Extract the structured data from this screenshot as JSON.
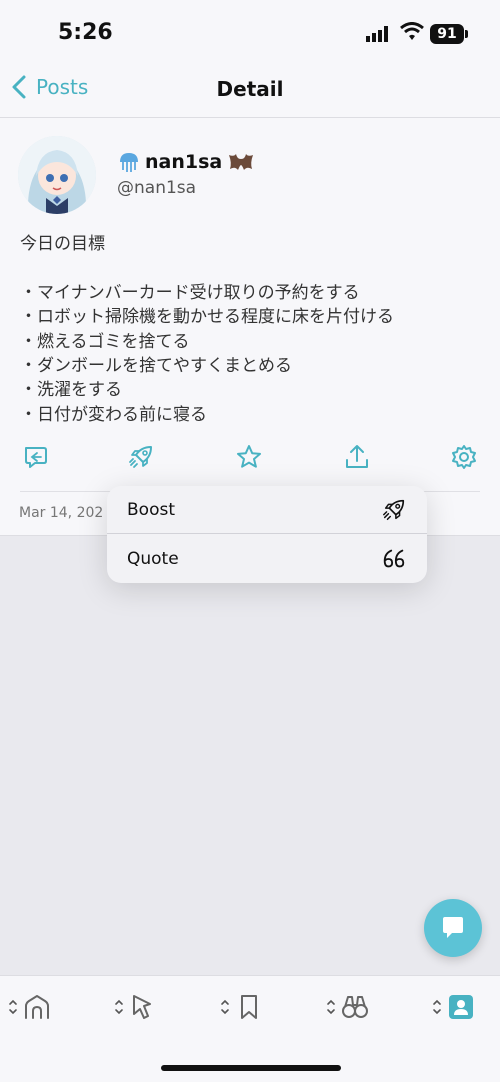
{
  "status_bar": {
    "time": "5:26",
    "battery": "91"
  },
  "nav": {
    "back_label": "Posts",
    "title": "Detail"
  },
  "post": {
    "display_name": "nan1sa",
    "handle": "@nan1sa",
    "content": "今日の目標\n\n・マイナンバーカード受け取りの予約をする\n・ロボット掃除機を動かせる程度に床を片付ける\n・燃えるゴミを捨てる\n・ダンボールを捨てやすくまとめる\n・洗濯をする\n・日付が変わる前に寝る",
    "date": "Mar 14, 202"
  },
  "actions": [
    "reply-icon",
    "boost-icon",
    "favourite-icon",
    "share-icon",
    "more-icon"
  ],
  "menu": {
    "boost_label": "Boost",
    "quote_label": "Quote"
  },
  "tabs": [
    "home-icon",
    "notifications-icon",
    "bookmark-icon",
    "explore-icon",
    "profile-icon"
  ],
  "colors": {
    "accent": "#48b2c2",
    "fab": "#5cc3d6"
  }
}
